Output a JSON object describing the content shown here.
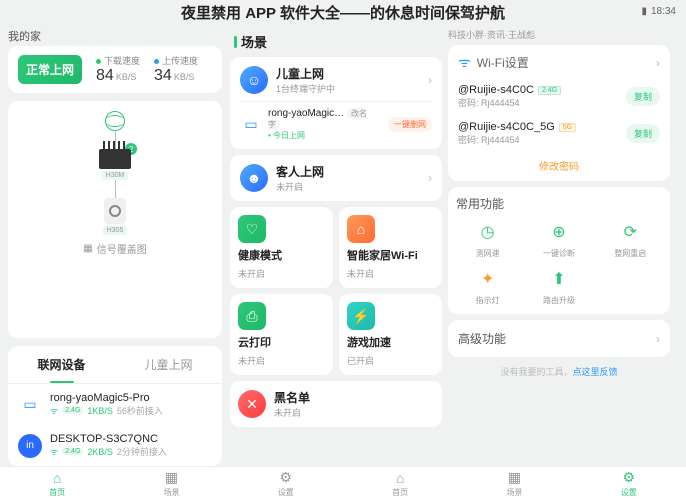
{
  "header": {
    "title": "夜里禁用 APP 软件大全——的休息时间保驾护航"
  },
  "status": {
    "time": "18:34"
  },
  "sub_header": {
    "line": "科技小胖·资讯·王战彪"
  },
  "left": {
    "mine_label": "我的家",
    "net_status": "正常上网",
    "down_label": "下载速度",
    "down_val": "84",
    "down_unit": "KB/S",
    "up_label": "上传速度",
    "up_val": "34",
    "up_unit": "KB/S",
    "router_label": "H30M",
    "cam_label": "H305",
    "signal_label": "信号覆盖图",
    "tabs": {
      "linked": "联网设备",
      "kids": "儿童上网"
    },
    "devs": [
      {
        "name": "rong-yaoMagic5-Pro",
        "band": "2.4G",
        "rate": "1KB/S",
        "ago": "56秒前接入"
      },
      {
        "name": "DESKTOP-S3C7QNC",
        "band": "2.4G",
        "rate": "2KB/S",
        "ago": "2分钟前接入"
      }
    ]
  },
  "mid": {
    "sec": "场景",
    "kid_title": "儿童上网",
    "kid_sub": "1台终端守护中",
    "kid_dev": "rong-yaoMagic…",
    "kid_dev_sub": "今日上网",
    "rename": "改名字",
    "del": "一键删网",
    "guest_title": "客人上网",
    "guest_sub": "未开启",
    "features": [
      {
        "title": "健康模式",
        "status": "未开启",
        "cls": "ic-green",
        "glyph": "♡"
      },
      {
        "title": "智能家居Wi-Fi",
        "status": "未开启",
        "cls": "ic-orange",
        "glyph": "⌂"
      },
      {
        "title": "云打印",
        "status": "未开启",
        "cls": "ic-green",
        "glyph": "⎙"
      },
      {
        "title": "游戏加速",
        "status": "已开启",
        "cls": "ic-teal",
        "glyph": "⚡"
      }
    ],
    "black_title": "黑名单",
    "black_sub": "未开启"
  },
  "right": {
    "wifi_set": "Wi-Fi设置",
    "ssids": [
      {
        "name": "@Ruijie-s4C0C",
        "tag": "2.4G",
        "tagcls": "tag24",
        "pw_label": "密码:",
        "pw": "Rj444454"
      },
      {
        "name": "@Ruijie-s4C0C_5G",
        "tag": "5G",
        "tagcls": "tag5g",
        "pw_label": "密码:",
        "pw": "Rj444454"
      }
    ],
    "copy": "复制",
    "change_pw": "修改密码",
    "tools_t": "常用功能",
    "tools": [
      {
        "label": "测网速",
        "glyph": "◷"
      },
      {
        "label": "一键诊断",
        "glyph": "⊕"
      },
      {
        "label": "整网重启",
        "glyph": "⟳"
      },
      {
        "label": "指示灯",
        "glyph": "✦",
        "orange": true
      },
      {
        "label": "路由升级",
        "glyph": "⬆"
      }
    ],
    "adv": "高级功能",
    "notools": "没有我要的工具，",
    "notools_link": "点这里反馈"
  },
  "nav": {
    "items": [
      "首页",
      "场景",
      "设置"
    ]
  }
}
